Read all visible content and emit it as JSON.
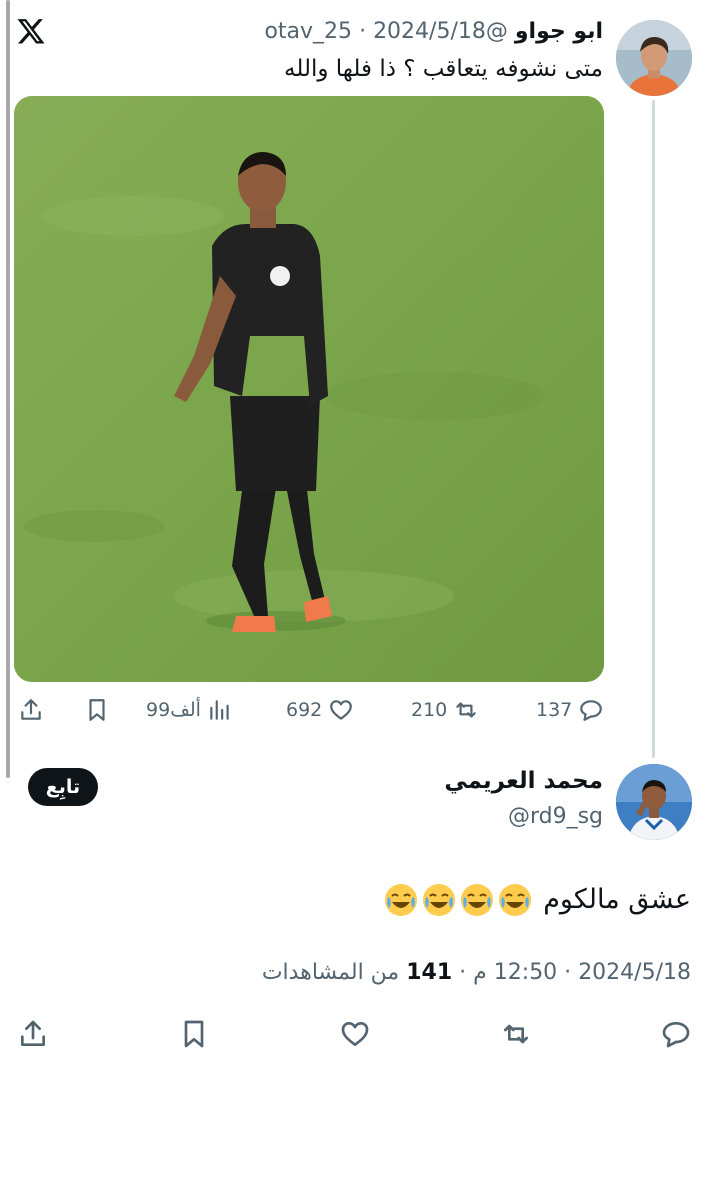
{
  "quoted_tweet": {
    "display_name": "ابو جواو",
    "handle": "@otav_25",
    "date": "2024/5/18",
    "separator": "·",
    "text": "متى نشوفه يتعاقب ؟ ذا فلها والله",
    "stats": {
      "replies": "137",
      "retweets": "210",
      "likes": "692",
      "views": "99ألف"
    }
  },
  "main_tweet": {
    "display_name": "محمد العريمي",
    "handle": "@rd9_sg",
    "follow_label": "تابِع",
    "text": "عشق مالكوم",
    "emoji_count": 4,
    "time": "12:50 م",
    "date": "2024/5/18",
    "views_count": "141",
    "views_label": "من المشاهدات"
  },
  "icons": [
    "x-logo-icon",
    "reply-icon",
    "retweet-icon",
    "like-icon",
    "views-icon",
    "bookmark-icon",
    "share-icon",
    "laughing-emoji-icon"
  ],
  "colors": {
    "text_primary": "#0f1419",
    "text_secondary": "#536471",
    "thread_line": "#cfd9de",
    "follow_bg": "#0f1419"
  }
}
